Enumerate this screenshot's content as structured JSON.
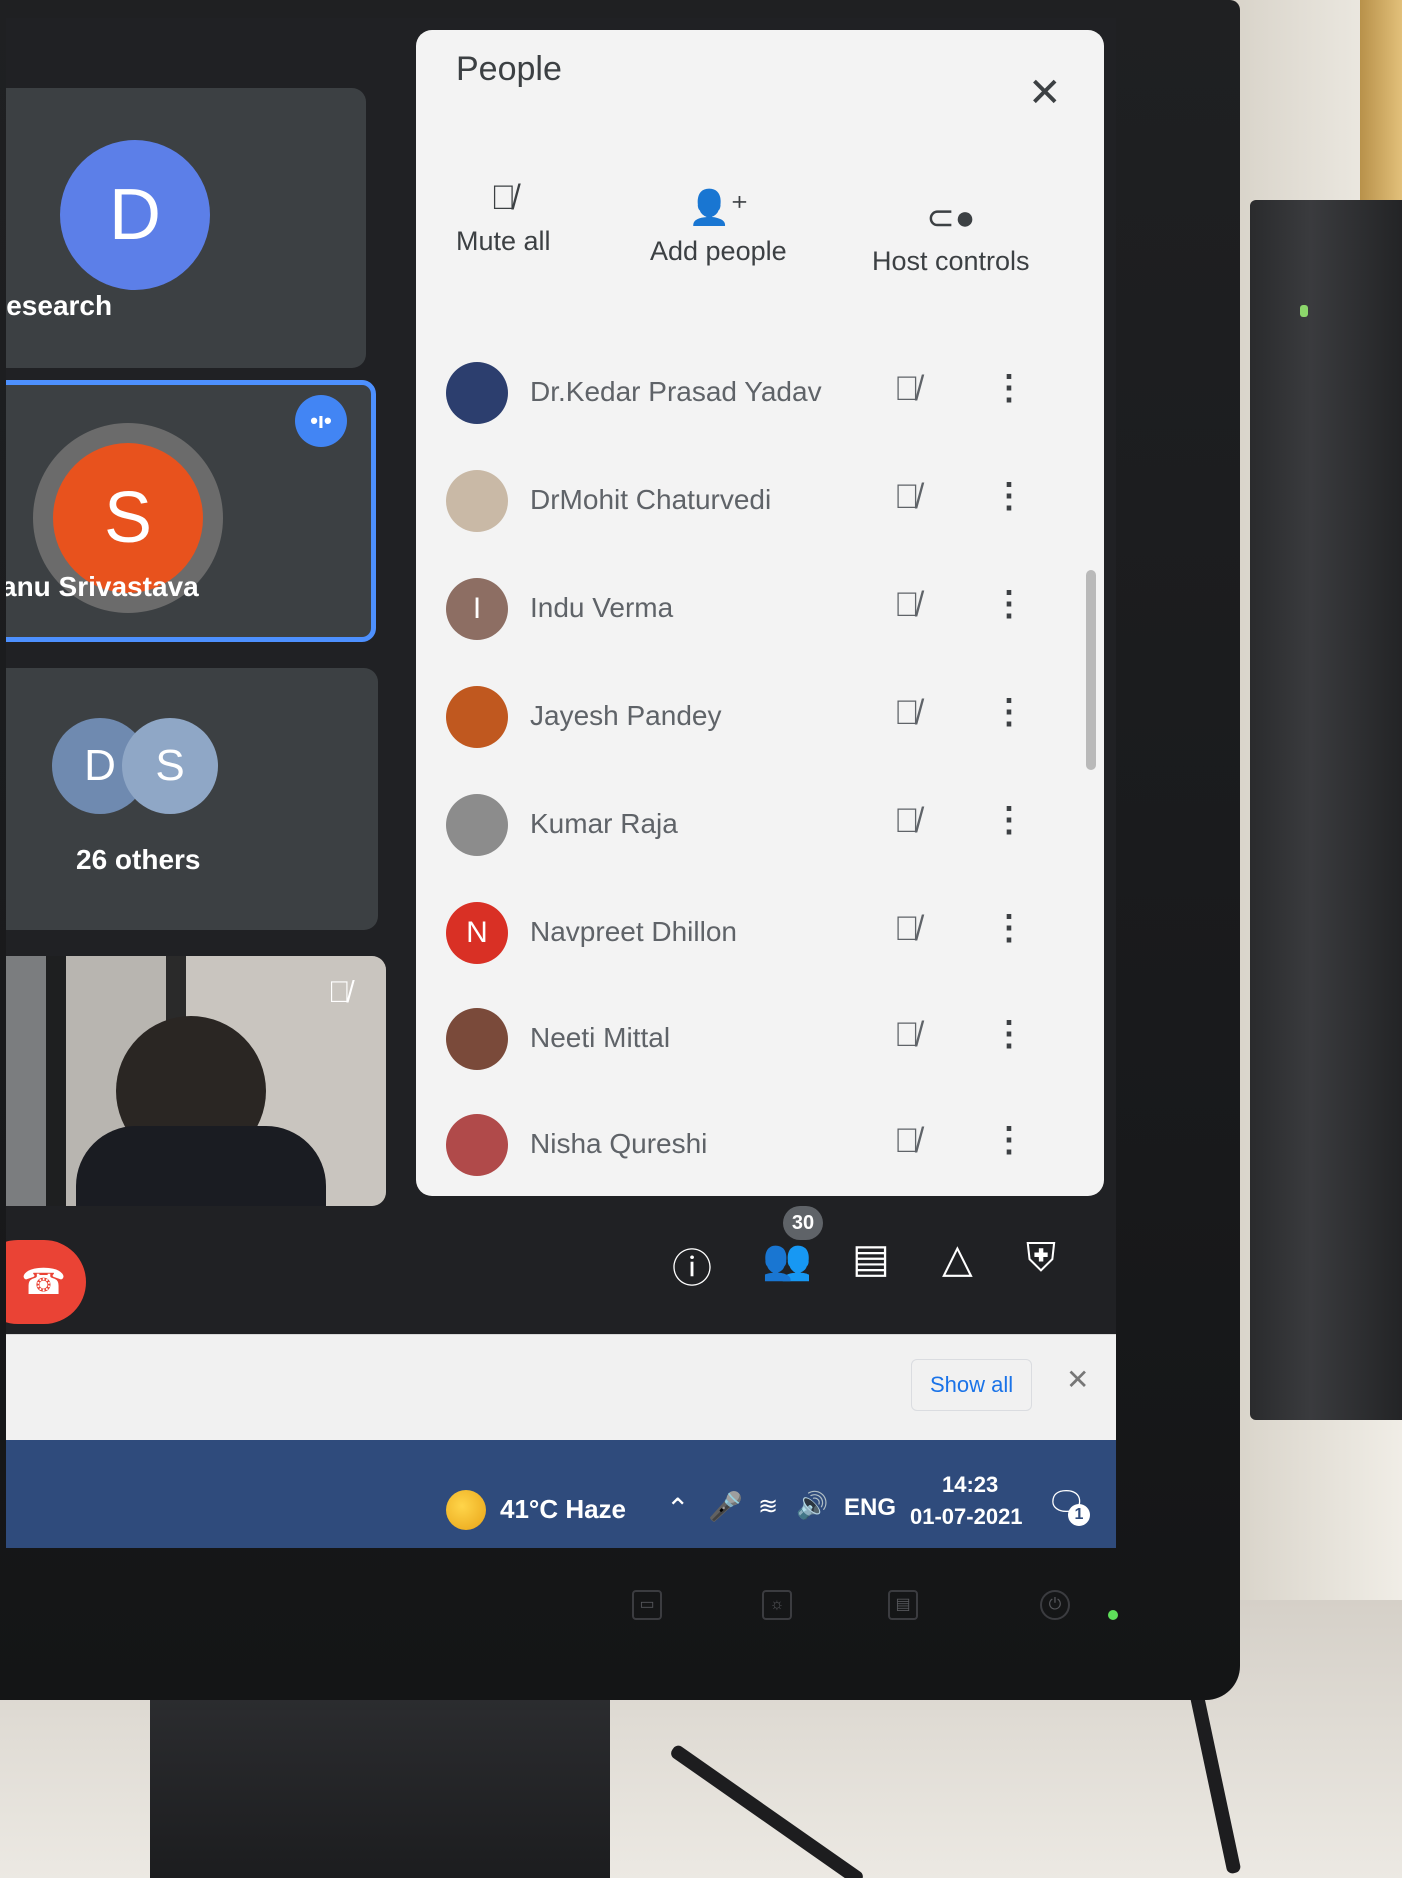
{
  "tiles": {
    "research": {
      "initial": "D",
      "name": "Research",
      "avatar_color": "#5c7fe8"
    },
    "speaker": {
      "initial": "S",
      "name": "anu Srivastava",
      "avatar_color": "#e8521d"
    },
    "others": {
      "initials": [
        "D",
        "S"
      ],
      "label": "26 others"
    }
  },
  "people_panel": {
    "title": "People",
    "actions": [
      {
        "label": "Mute all",
        "icon": "mic-off-icon"
      },
      {
        "label": "Add people",
        "icon": "person-add-icon"
      },
      {
        "label": "Host controls",
        "icon": "toggle-icon"
      }
    ],
    "participants": [
      {
        "name": "Dr.Kedar Prasad Yadav",
        "initial": "",
        "color": "#2c3e6e"
      },
      {
        "name": "DrMohit Chaturvedi",
        "initial": "",
        "color": "#c9b9a6"
      },
      {
        "name": "Indu Verma",
        "initial": "I",
        "color": "#8d6e63"
      },
      {
        "name": "Jayesh Pandey",
        "initial": "",
        "color": "#c0581f"
      },
      {
        "name": "Kumar Raja",
        "initial": "",
        "color": "#8c8c8c"
      },
      {
        "name": "Navpreet Dhillon",
        "initial": "N",
        "color": "#d93025"
      },
      {
        "name": "Neeti Mittal",
        "initial": "",
        "color": "#7a4a3a"
      },
      {
        "name": "Nisha Qureshi",
        "initial": "",
        "color": "#b04a4a"
      }
    ]
  },
  "bottom_bar": {
    "people_count": "30",
    "icons": [
      "info-icon",
      "people-icon",
      "chat-icon",
      "activities-icon",
      "host-shield-icon"
    ]
  },
  "download_bar": {
    "show_all": "Show all"
  },
  "taskbar": {
    "weather": "41°C  Haze",
    "language": "ENG",
    "time": "14:23",
    "date": "01-07-2021",
    "notifications": "1"
  }
}
